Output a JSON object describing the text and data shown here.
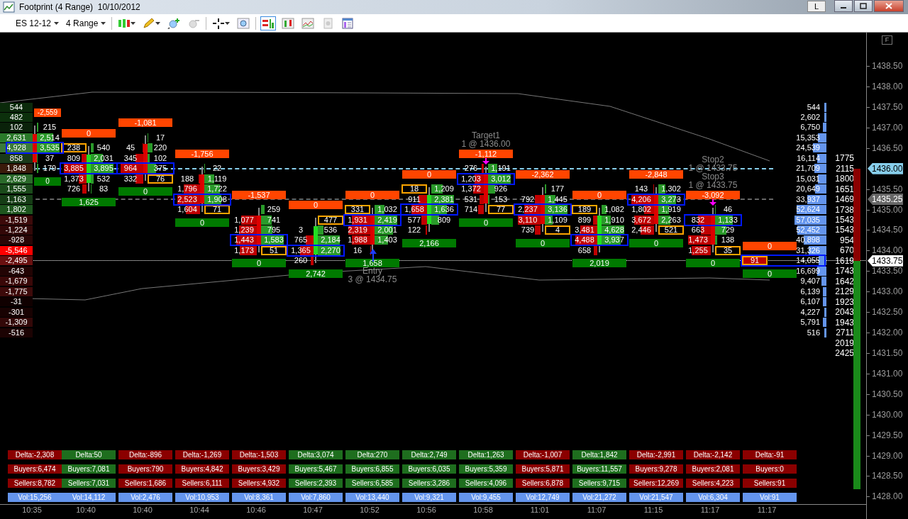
{
  "window": {
    "title": "Footprint (4 Range)",
    "date": "10/10/2012",
    "button": "L"
  },
  "toolbar": {
    "instrument": "ES 12-12",
    "period": "4 Range"
  },
  "chart_corner": "F",
  "ladder": [
    {
      "value": "544",
      "color": "#0b2a0b"
    },
    {
      "value": "482",
      "color": "#0c300c"
    },
    {
      "value": "102",
      "color": "#0a220a"
    },
    {
      "value": "2,631",
      "color": "#2a7a2a"
    },
    {
      "value": "4,928",
      "color": "#3a7a3a"
    },
    {
      "value": "858",
      "color": "#1a3a1a"
    },
    {
      "value": "1,848",
      "color": "#3a1a0a"
    },
    {
      "value": "2,629",
      "color": "#2a6a2a"
    },
    {
      "value": "1,555",
      "color": "#1a4a1a"
    },
    {
      "value": "1,163",
      "color": "#153d15"
    },
    {
      "value": "1,802",
      "color": "#1e551e"
    },
    {
      "value": "-1,519",
      "color": "#3d0a0a"
    },
    {
      "value": "-1,224",
      "color": "#330808"
    },
    {
      "value": "-928",
      "color": "#2a0606"
    },
    {
      "value": "-5,546",
      "color": "#ff0000"
    },
    {
      "value": "-2,495",
      "color": "#6a1010"
    },
    {
      "value": "-643",
      "color": "#220404"
    },
    {
      "value": "-1,679",
      "color": "#3a0808"
    },
    {
      "value": "-1,775",
      "color": "#3d0a0a"
    },
    {
      "value": "-31",
      "color": "#100000"
    },
    {
      "value": "-301",
      "color": "#180202"
    },
    {
      "value": "-1,309",
      "color": "#330808"
    },
    {
      "value": "-516",
      "color": "#1c0303"
    }
  ],
  "bars": [
    {
      "time": "10:35",
      "rising": false,
      "delta": "-2,559",
      "total": "0",
      "rows": [
        {
          "ask": "215",
          "highlight": false,
          "ask_boxed": false
        },
        {
          "ask": "2,514",
          "highlight": false,
          "ask_boxed": false
        },
        {
          "ask": "3,535",
          "highlight": true,
          "ask_boxed": false
        },
        {
          "ask": "37",
          "highlight": false,
          "ask_boxed": false
        },
        {
          "ask": "179",
          "highlight": false,
          "ask_boxed": false
        }
      ],
      "bullish": false,
      "stats": {
        "delta": "Delta:-2,308",
        "buyers": "Buyers:6,474",
        "sellers": "Sellers:8,782",
        "vol": "Vol:15,256"
      }
    },
    {
      "time": "10:40",
      "rising": true,
      "delta": "0",
      "total": "1,625",
      "rows": [
        {
          "bid": "238",
          "ask": "540",
          "highlight": false,
          "bid_boxed": true,
          "ask_boxed": false
        },
        {
          "bid": "809",
          "ask": "2,031",
          "highlight": false,
          "bid_boxed": false,
          "ask_boxed": false
        },
        {
          "bid": "3,885",
          "ask": "3,895",
          "highlight": true,
          "bid_boxed": false,
          "ask_boxed": false
        },
        {
          "bid": "1,373",
          "ask": "532",
          "highlight": false,
          "bid_boxed": false,
          "ask_boxed": false
        },
        {
          "bid": "726",
          "ask": "83",
          "highlight": false,
          "bid_boxed": false,
          "ask_boxed": false
        }
      ],
      "bullish": true,
      "stats": {
        "delta": "Delta:50",
        "buyers": "Buyers:7,081",
        "sellers": "Sellers:7,031",
        "vol": "Vol:14,112"
      }
    },
    {
      "time": "10:40",
      "rising": false,
      "delta": "-1,081",
      "total": "0",
      "rows": [
        {
          "ask": "17",
          "highlight": false,
          "ask_boxed": false
        },
        {
          "bid": "45",
          "ask": "220",
          "highlight": false,
          "bid_boxed": false,
          "ask_boxed": false
        },
        {
          "bid": "345",
          "ask": "102",
          "highlight": false,
          "bid_boxed": false,
          "ask_boxed": false
        },
        {
          "bid": "964",
          "ask": "375",
          "highlight": true,
          "bid_boxed": false,
          "ask_boxed": false
        },
        {
          "bid": "332",
          "ask": "76",
          "highlight": false,
          "bid_boxed": false,
          "ask_boxed": true
        }
      ],
      "bullish": false,
      "stats": {
        "delta": "Delta:-896",
        "buyers": "Buyers:790",
        "sellers": "Sellers:1,686",
        "vol": "Vol:2,476"
      }
    },
    {
      "time": "10:44",
      "rising": false,
      "delta": "-1,756",
      "total": "0",
      "rows": [
        {
          "ask": "22",
          "highlight": false,
          "ask_boxed": false
        },
        {
          "bid": "188",
          "ask": "1,119",
          "highlight": false,
          "bid_boxed": false,
          "ask_boxed": false
        },
        {
          "bid": "1,796",
          "ask": "1,722",
          "highlight": false,
          "bid_boxed": false,
          "ask_boxed": false
        },
        {
          "bid": "2,523",
          "ask": "1,908",
          "highlight": true,
          "bid_boxed": false,
          "ask_boxed": false
        },
        {
          "bid": "1,604",
          "ask": "71",
          "highlight": false,
          "bid_boxed": false,
          "ask_boxed": true
        }
      ],
      "bullish": false,
      "stats": {
        "delta": "Delta:-1,269",
        "buyers": "Buyers:4,842",
        "sellers": "Sellers:6,111",
        "vol": "Vol:10,953"
      }
    },
    {
      "time": "10:46",
      "rising": false,
      "delta": "-1,537",
      "total": "0",
      "rows": [
        {
          "ask": "259",
          "highlight": false,
          "ask_boxed": false
        },
        {
          "bid": "1,077",
          "ask": "741",
          "highlight": false,
          "bid_boxed": false,
          "ask_boxed": false
        },
        {
          "bid": "1,239",
          "ask": "795",
          "highlight": false,
          "bid_boxed": false,
          "ask_boxed": false
        },
        {
          "bid": "1,443",
          "ask": "1,583",
          "highlight": true,
          "bid_boxed": false,
          "ask_boxed": false
        },
        {
          "bid": "1,173",
          "ask": "51",
          "highlight": false,
          "bid_boxed": false,
          "ask_boxed": true
        }
      ],
      "bullish": false,
      "stats": {
        "delta": "Delta:-1,503",
        "buyers": "Buyers:3,429",
        "sellers": "Sellers:4,932",
        "vol": "Vol:8,361"
      }
    },
    {
      "time": "10:47",
      "rising": true,
      "delta": "0",
      "total": "2,742",
      "rows": [
        {
          "ask": "477",
          "highlight": false,
          "ask_boxed": true
        },
        {
          "bid": "3",
          "ask": "536",
          "highlight": false,
          "bid_boxed": false,
          "ask_boxed": false
        },
        {
          "bid": "765",
          "ask": "2,184",
          "highlight": false,
          "bid_boxed": false,
          "ask_boxed": false
        },
        {
          "bid": "1,365",
          "ask": "2,270",
          "highlight": true,
          "bid_boxed": false,
          "ask_boxed": false
        },
        {
          "bid": "260",
          "highlight": false,
          "bid_boxed": false
        }
      ],
      "bullish": true,
      "stats": {
        "delta": "Delta:3,074",
        "buyers": "Buyers:5,467",
        "sellers": "Sellers:2,393",
        "vol": "Vol:7,860"
      }
    },
    {
      "time": "10:52",
      "rising": false,
      "delta": "0",
      "total": "1,658",
      "rows": [
        {
          "bid": "331",
          "ask": "1,032",
          "highlight": false,
          "bid_boxed": true,
          "ask_boxed": false
        },
        {
          "bid": "1,931",
          "ask": "2,419",
          "highlight": true,
          "bid_boxed": false,
          "ask_boxed": false
        },
        {
          "bid": "2,319",
          "ask": "2,001",
          "highlight": false,
          "bid_boxed": false,
          "ask_boxed": false
        },
        {
          "bid": "1,988",
          "ask": "1,403",
          "highlight": false,
          "bid_boxed": false,
          "ask_boxed": false
        },
        {
          "bid": "16",
          "highlight": false,
          "bid_boxed": false
        }
      ],
      "orders": [
        {
          "kind": "entry",
          "label": "Entry",
          "detail": "3 @ 1434.75"
        }
      ],
      "bullish": true,
      "stats": {
        "delta": "Delta:270",
        "buyers": "Buyers:6,855",
        "sellers": "Sellers:6,585",
        "vol": "Vol:13,440"
      }
    },
    {
      "time": "10:56",
      "rising": true,
      "delta": "0",
      "total": "2,166",
      "rows": [
        {
          "bid": "18",
          "ask": "1,209",
          "highlight": false,
          "bid_boxed": true,
          "ask_boxed": false
        },
        {
          "bid": "911",
          "ask": "2,381",
          "highlight": false,
          "bid_boxed": false,
          "ask_boxed": false
        },
        {
          "bid": "1,658",
          "ask": "1,636",
          "highlight": true,
          "bid_boxed": false,
          "ask_boxed": false
        },
        {
          "bid": "577",
          "ask": "809",
          "highlight": false,
          "bid_boxed": false,
          "ask_boxed": false
        },
        {
          "bid": "122",
          "highlight": false,
          "bid_boxed": false
        }
      ],
      "bullish": true,
      "stats": {
        "delta": "Delta:2,749",
        "buyers": "Buyers:6,035",
        "sellers": "Sellers:3,286",
        "vol": "Vol:9,321"
      }
    },
    {
      "time": "10:58",
      "rising": false,
      "delta": "-1,112",
      "total": "0",
      "rows": [
        {
          "bid": "276",
          "ask": "1,191",
          "highlight": false,
          "bid_boxed": false,
          "ask_boxed": false
        },
        {
          "bid": "1,203",
          "ask": "3,012",
          "highlight": true,
          "bid_boxed": false,
          "ask_boxed": false
        },
        {
          "bid": "1,372",
          "ask": "926",
          "highlight": false,
          "bid_boxed": false,
          "ask_boxed": false
        },
        {
          "bid": "531",
          "ask": "153",
          "highlight": false,
          "bid_boxed": false,
          "ask_boxed": false
        },
        {
          "bid": "714",
          "ask": "77",
          "highlight": false,
          "bid_boxed": false,
          "ask_boxed": true
        }
      ],
      "orders": [
        {
          "kind": "target",
          "label": "Target1",
          "detail": "1 @ 1436.00"
        }
      ],
      "bullish": true,
      "stats": {
        "delta": "Delta:1,263",
        "buyers": "Buyers:5,359",
        "sellers": "Sellers:4,096",
        "vol": "Vol:9,455"
      }
    },
    {
      "time": "11:01",
      "rising": false,
      "delta": "-2,362",
      "total": "0",
      "rows": [
        {
          "ask": "177",
          "highlight": false,
          "ask_boxed": false
        },
        {
          "bid": "792",
          "ask": "1,445",
          "highlight": false,
          "bid_boxed": false,
          "ask_boxed": false
        },
        {
          "bid": "2,237",
          "ask": "3,136",
          "highlight": true,
          "bid_boxed": false,
          "ask_boxed": false
        },
        {
          "bid": "3,110",
          "ask": "1,109",
          "highlight": false,
          "bid_boxed": false,
          "ask_boxed": false
        },
        {
          "bid": "739",
          "ask": "4",
          "highlight": false,
          "bid_boxed": false,
          "ask_boxed": true
        }
      ],
      "bullish": false,
      "stats": {
        "delta": "Delta:-1,007",
        "buyers": "Buyers:5,871",
        "sellers": "Sellers:6,878",
        "vol": "Vol:12,749"
      }
    },
    {
      "time": "11:07",
      "rising": true,
      "delta": "0",
      "total": "2,019",
      "rows": [
        {
          "bid": "189",
          "ask": "1,082",
          "highlight": false,
          "bid_boxed": true,
          "ask_boxed": false
        },
        {
          "bid": "899",
          "ask": "1,910",
          "highlight": false,
          "bid_boxed": false,
          "ask_boxed": false
        },
        {
          "bid": "3,481",
          "ask": "4,628",
          "highlight": false,
          "bid_boxed": false,
          "ask_boxed": false
        },
        {
          "bid": "4,488",
          "ask": "3,937",
          "highlight": true,
          "bid_boxed": false,
          "ask_boxed": false
        },
        {
          "bid": "658",
          "highlight": false,
          "bid_boxed": false
        }
      ],
      "bullish": true,
      "stats": {
        "delta": "Delta:1,842",
        "buyers": "Buyers:11,557",
        "sellers": "Sellers:9,715",
        "vol": "Vol:21,272"
      }
    },
    {
      "time": "11:15",
      "rising": false,
      "delta": "-2,848",
      "total": "0",
      "rows": [
        {
          "bid": "143",
          "ask": "1,302",
          "highlight": false,
          "bid_boxed": false,
          "ask_boxed": false
        },
        {
          "bid": "4,206",
          "ask": "3,273",
          "highlight": true,
          "bid_boxed": false,
          "ask_boxed": false
        },
        {
          "bid": "1,802",
          "ask": "1,919",
          "highlight": false,
          "bid_boxed": false,
          "ask_boxed": false
        },
        {
          "bid": "3,672",
          "ask": "2,263",
          "highlight": false,
          "bid_boxed": false,
          "ask_boxed": false
        },
        {
          "bid": "2,446",
          "ask": "521",
          "highlight": false,
          "bid_boxed": false,
          "ask_boxed": true
        }
      ],
      "bullish": false,
      "stats": {
        "delta": "Delta:-2,991",
        "buyers": "Buyers:9,278",
        "sellers": "Sellers:12,269",
        "vol": "Vol:21,547"
      }
    },
    {
      "time": "11:17",
      "rising": false,
      "delta": "-3,092",
      "total": "0",
      "rows": [
        {
          "ask": "46",
          "highlight": false,
          "ask_boxed": false
        },
        {
          "bid": "832",
          "ask": "1,133",
          "highlight": true,
          "bid_boxed": false,
          "ask_boxed": false
        },
        {
          "bid": "663",
          "ask": "729",
          "highlight": false,
          "bid_boxed": false,
          "ask_boxed": false
        },
        {
          "bid": "1,473",
          "ask": "138",
          "highlight": false,
          "bid_boxed": false,
          "ask_boxed": false
        },
        {
          "bid": "1,255",
          "ask": "35",
          "highlight": false,
          "bid_boxed": false,
          "ask_boxed": true
        }
      ],
      "orders": [
        {
          "kind": "stop",
          "label": "Stop2",
          "detail": "1 @ 1433.75"
        },
        {
          "kind": "stop",
          "label": "Stop3",
          "detail": "1 @ 1433.75"
        }
      ],
      "bullish": false,
      "stats": {
        "delta": "Delta:-2,142",
        "buyers": "Buyers:2,081",
        "sellers": "Sellers:4,223",
        "vol": "Vol:6,304"
      }
    },
    {
      "time": "11:17",
      "delta": "0",
      "total": "0",
      "rows": [
        {
          "bid": "91",
          "highlight": true,
          "bid_boxed": true
        }
      ],
      "bullish": false,
      "stats": {
        "delta": "Delta:-91",
        "buyers": "Buyers:0",
        "sellers": "Sellers:91",
        "vol": "Vol:91"
      }
    }
  ],
  "profile": [
    "544",
    "2,602",
    "6,750",
    "15,353",
    "24,539",
    "16,114",
    "21,709",
    "15,031",
    "20,649",
    "33,937",
    "52,624",
    "57,035",
    "52,452",
    "40,898",
    "31,326",
    "14,055",
    "16,699",
    "9,407",
    "6,139",
    "6,107",
    "4,227",
    "5,791",
    "516"
  ],
  "counts": [
    "1775",
    "2115",
    "1800",
    "1651",
    "1469",
    "1738",
    "1543",
    "1543",
    "954",
    "670",
    "1619",
    "1743",
    "1642",
    "2129",
    "1923",
    "2043",
    "1943",
    "2711",
    "2019",
    "2425"
  ],
  "axis_labels": [
    "1438.50",
    "1438.00",
    "1437.50",
    "1437.00",
    "1436.50",
    "1435.50",
    "1435.00",
    "1434.50",
    "1434.00",
    "1433.50",
    "1433.00",
    "1432.50",
    "1432.00",
    "1431.50",
    "1431.00",
    "1430.50",
    "1430.00",
    "1429.50",
    "1429.00",
    "1428.50",
    "1428.00"
  ],
  "price_flags": [
    {
      "price": "1436.00",
      "color": "#87ceeb",
      "kind": "dashed"
    },
    {
      "price": "1435.25",
      "color": "#666666",
      "kind": "dashed"
    },
    {
      "price": "1433.75",
      "color": "#ffffff",
      "kind": "dotted"
    }
  ]
}
